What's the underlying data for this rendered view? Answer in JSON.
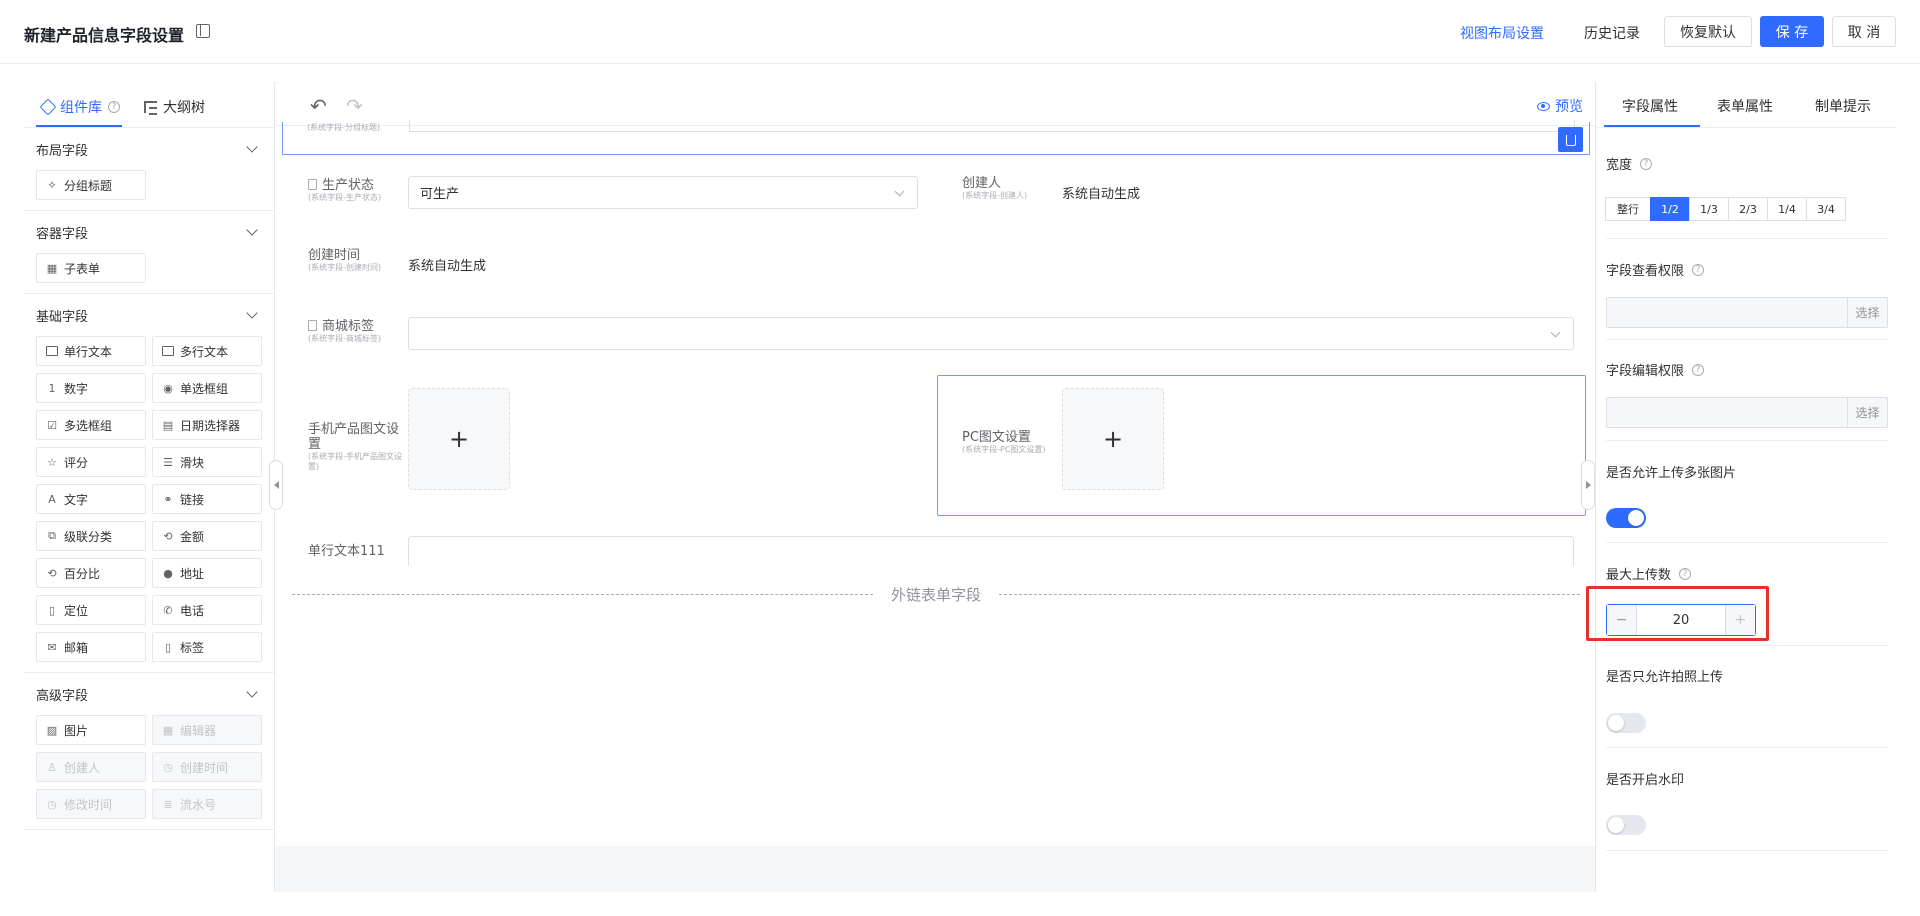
{
  "header": {
    "title": "新建产品信息字段设置",
    "view_layout": "视图布局设置",
    "history": "历史记录",
    "restore": "恢复默认",
    "save": "保 存",
    "cancel": "取 消"
  },
  "left": {
    "tab_components": "组件库",
    "tab_outline": "大纲树",
    "groups": [
      {
        "title": "布局字段",
        "items": [
          {
            "label": "分组标题",
            "icon": "group-title-icon",
            "disabled": false
          }
        ]
      },
      {
        "title": "容器字段",
        "items": [
          {
            "label": "子表单",
            "icon": "table-icon",
            "disabled": false
          }
        ]
      },
      {
        "title": "基础字段",
        "items": [
          {
            "label": "单行文本",
            "icon": "single-line-icon",
            "disabled": false
          },
          {
            "label": "多行文本",
            "icon": "multi-line-icon",
            "disabled": false
          },
          {
            "label": "数字",
            "icon": "number-icon",
            "disabled": false
          },
          {
            "label": "单选框组",
            "icon": "radio-icon",
            "disabled": false
          },
          {
            "label": "多选框组",
            "icon": "checkbox-icon",
            "disabled": false
          },
          {
            "label": "日期选择器",
            "icon": "calendar-icon",
            "disabled": false
          },
          {
            "label": "评分",
            "icon": "star-icon",
            "disabled": false
          },
          {
            "label": "滑块",
            "icon": "slider-icon",
            "disabled": false
          },
          {
            "label": "文字",
            "icon": "text-icon",
            "disabled": false
          },
          {
            "label": "链接",
            "icon": "link-icon",
            "disabled": false
          },
          {
            "label": "级联分类",
            "icon": "cascade-icon",
            "disabled": false
          },
          {
            "label": "金额",
            "icon": "amount-icon",
            "disabled": false
          },
          {
            "label": "百分比",
            "icon": "percent-icon",
            "disabled": false
          },
          {
            "label": "地址",
            "icon": "location-pin-icon",
            "disabled": false
          },
          {
            "label": "定位",
            "icon": "document-icon",
            "disabled": false
          },
          {
            "label": "电话",
            "icon": "phone-icon",
            "disabled": false
          },
          {
            "label": "邮箱",
            "icon": "mail-icon",
            "disabled": false
          },
          {
            "label": "标签",
            "icon": "bookmark-icon",
            "disabled": false
          }
        ]
      },
      {
        "title": "高级字段",
        "items": [
          {
            "label": "图片",
            "icon": "image-icon",
            "disabled": false
          },
          {
            "label": "编辑器",
            "icon": "editor-icon",
            "disabled": true
          },
          {
            "label": "创建人",
            "icon": "user-icon",
            "disabled": true
          },
          {
            "label": "创建时间",
            "icon": "clock-icon",
            "disabled": true
          },
          {
            "label": "修改时间",
            "icon": "clock-icon",
            "disabled": true
          },
          {
            "label": "流水号",
            "icon": "list-number-icon",
            "disabled": true
          }
        ]
      }
    ]
  },
  "center": {
    "preview": "预览",
    "top_sub": "(系统字段-分组标题)",
    "fields": {
      "status_label": "生产状态",
      "status_sub": "(系统字段-生产状态)",
      "status_value": "可生产",
      "creator_label": "创建人",
      "creator_sub": "(系统字段-创建人)",
      "creator_value": "系统自动生成",
      "ctime_label": "创建时间",
      "ctime_sub": "(系统字段-创建时间)",
      "ctime_value": "系统自动生成",
      "mall_label": "商城标签",
      "mall_sub": "(系统字段-商城标签)",
      "mobile_label": "手机产品图文设置",
      "mobile_sub": "(系统字段-手机产品图文设置)",
      "pc_label": "PC图文设置",
      "pc_sub": "(系统字段-PC图文设置)",
      "single_label": "单行文本111",
      "plus": "+",
      "divider": "外链表单字段"
    }
  },
  "right": {
    "tabs": [
      "字段属性",
      "表单属性",
      "制单提示"
    ],
    "width_label": "宽度",
    "width_options": [
      "整行",
      "1/2",
      "1/3",
      "2/3",
      "1/4",
      "3/4"
    ],
    "width_selected": "1/2",
    "view_perm": "字段查看权限",
    "edit_perm": "字段编辑权限",
    "select_btn": "选择",
    "multi_upload": "是否允许上传多张图片",
    "multi_upload_on": true,
    "max_upload": "最大上传数",
    "max_upload_value": "20",
    "photo_only": "是否只允许拍照上传",
    "photo_only_on": false,
    "watermark": "是否开启水印",
    "watermark_on": false
  }
}
